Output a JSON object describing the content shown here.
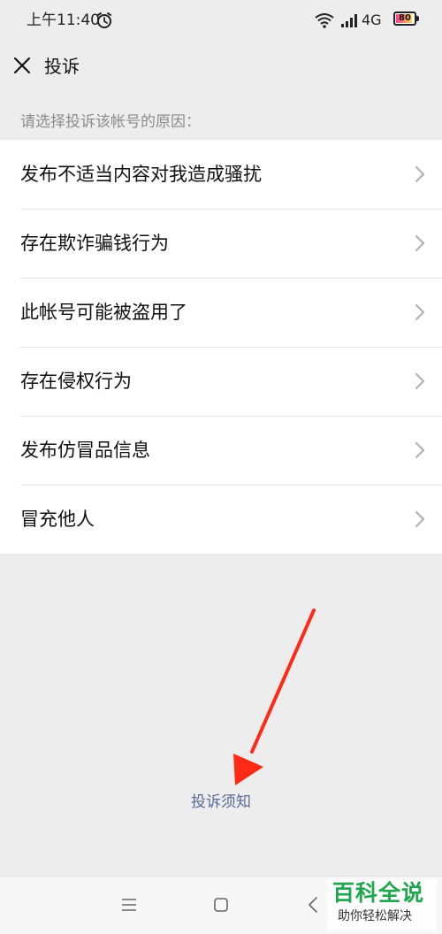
{
  "status_bar": {
    "time": "上午11:40",
    "network": "4G",
    "battery_level": "80",
    "icons": [
      "alarm-icon",
      "wifi-icon",
      "signal-icon",
      "battery-icon"
    ]
  },
  "header": {
    "title": "投诉",
    "close_icon": "close-icon"
  },
  "section": {
    "hint": "请选择投诉该帐号的原因："
  },
  "reasons": [
    {
      "label": "发布不适当内容对我造成骚扰"
    },
    {
      "label": "存在欺诈骗钱行为"
    },
    {
      "label": "此帐号可能被盗用了"
    },
    {
      "label": "存在侵权行为"
    },
    {
      "label": "发布仿冒品信息"
    },
    {
      "label": "冒充他人"
    }
  ],
  "footer": {
    "notice_link": "投诉须知"
  },
  "system_nav": {
    "icons": [
      "menu-icon",
      "home-icon",
      "back-icon"
    ]
  },
  "watermark": {
    "title": "百科全说",
    "subtitle": "助你轻松解决"
  },
  "colors": {
    "background": "#ededed",
    "list_background": "#ffffff",
    "link": "#576b95",
    "hint_text": "#8c8c8c",
    "arrow": "#ff2a16",
    "watermark_green": "#21a650"
  }
}
